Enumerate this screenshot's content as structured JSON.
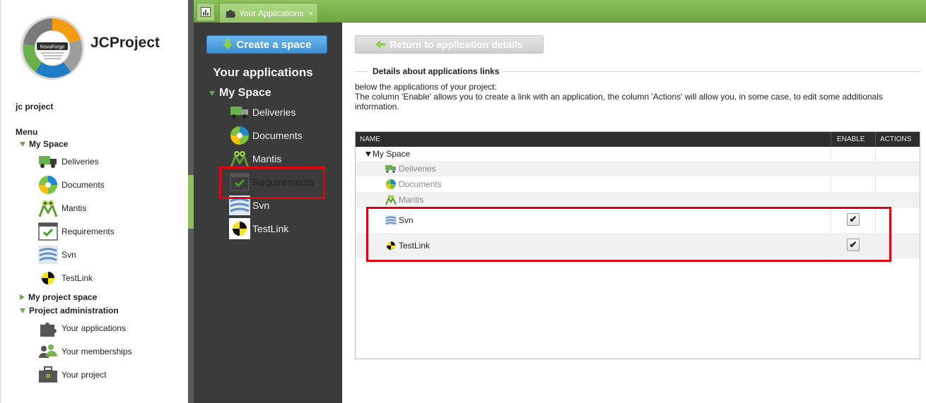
{
  "app": {
    "project_name": "JCProject",
    "project_small": "jc project",
    "logo_center_text": "NovaForge",
    "logo_ring_labels": [
      "Control",
      "Integration",
      "Deployment",
      "Collaboration",
      "Support"
    ]
  },
  "sidebar": {
    "menu_title": "Menu",
    "groups": [
      {
        "label": "My Space",
        "expanded": true,
        "items": [
          {
            "label": "Deliveries",
            "icon": "truck-icon"
          },
          {
            "label": "Documents",
            "icon": "flower-icon"
          },
          {
            "label": "Mantis",
            "icon": "mantis-icon"
          },
          {
            "label": "Requirements",
            "icon": "checklist-icon"
          },
          {
            "label": "Svn",
            "icon": "svn-icon"
          },
          {
            "label": "TestLink",
            "icon": "testlink-icon"
          }
        ]
      },
      {
        "label": "My project space",
        "expanded": false,
        "items": []
      },
      {
        "label": "Project administration",
        "expanded": true,
        "items": [
          {
            "label": "Your applications",
            "icon": "puzzle-icon"
          },
          {
            "label": "Your memberships",
            "icon": "users-icon"
          },
          {
            "label": "Your project",
            "icon": "briefcase-icon"
          }
        ]
      }
    ]
  },
  "tabs": {
    "home_icon": "chart-icon",
    "active_tab": {
      "label": "Your Applications",
      "icon": "puzzle-icon",
      "close": "×"
    }
  },
  "mid": {
    "create_button": "Create a space",
    "title": "Your applications",
    "space": "My Space",
    "items": [
      {
        "label": "Deliveries",
        "icon": "truck-icon"
      },
      {
        "label": "Documents",
        "icon": "flower-icon"
      },
      {
        "label": "Mantis",
        "icon": "mantis-icon"
      },
      {
        "label": "Requirements",
        "icon": "checklist-icon",
        "highlighted": true
      },
      {
        "label": "Svn",
        "icon": "svn-icon"
      },
      {
        "label": "TestLink",
        "icon": "testlink-icon"
      }
    ]
  },
  "content": {
    "return_button": "Return to application details",
    "legend": "Details about applications links",
    "desc_line1": "below the applications of your project:",
    "desc_line2": "The column 'Enable' allows you to create a link with an application, the column 'Actions' will allow you, in some case, to edit some additionals information.",
    "grid": {
      "columns": [
        "NAME",
        "ENABLE",
        "ACTIONS"
      ],
      "group": "My Space",
      "rows": [
        {
          "name": "Deliveries",
          "icon": "truck-icon",
          "linked": false,
          "enable": false
        },
        {
          "name": "Documents",
          "icon": "flower-icon",
          "linked": false,
          "enable": false
        },
        {
          "name": "Mantis",
          "icon": "mantis-icon",
          "linked": false,
          "enable": false
        },
        {
          "name": "Svn",
          "icon": "svn-icon",
          "linked": true,
          "enable": true
        },
        {
          "name": "TestLink",
          "icon": "testlink-icon",
          "linked": true,
          "enable": true
        }
      ],
      "check_glyph": "✔"
    }
  },
  "colors": {
    "accent_green": "#7cb34f",
    "highlight_red": "#e3000f",
    "button_blue": "#3b8fd2",
    "dark_panel": "#3b3b3b"
  }
}
